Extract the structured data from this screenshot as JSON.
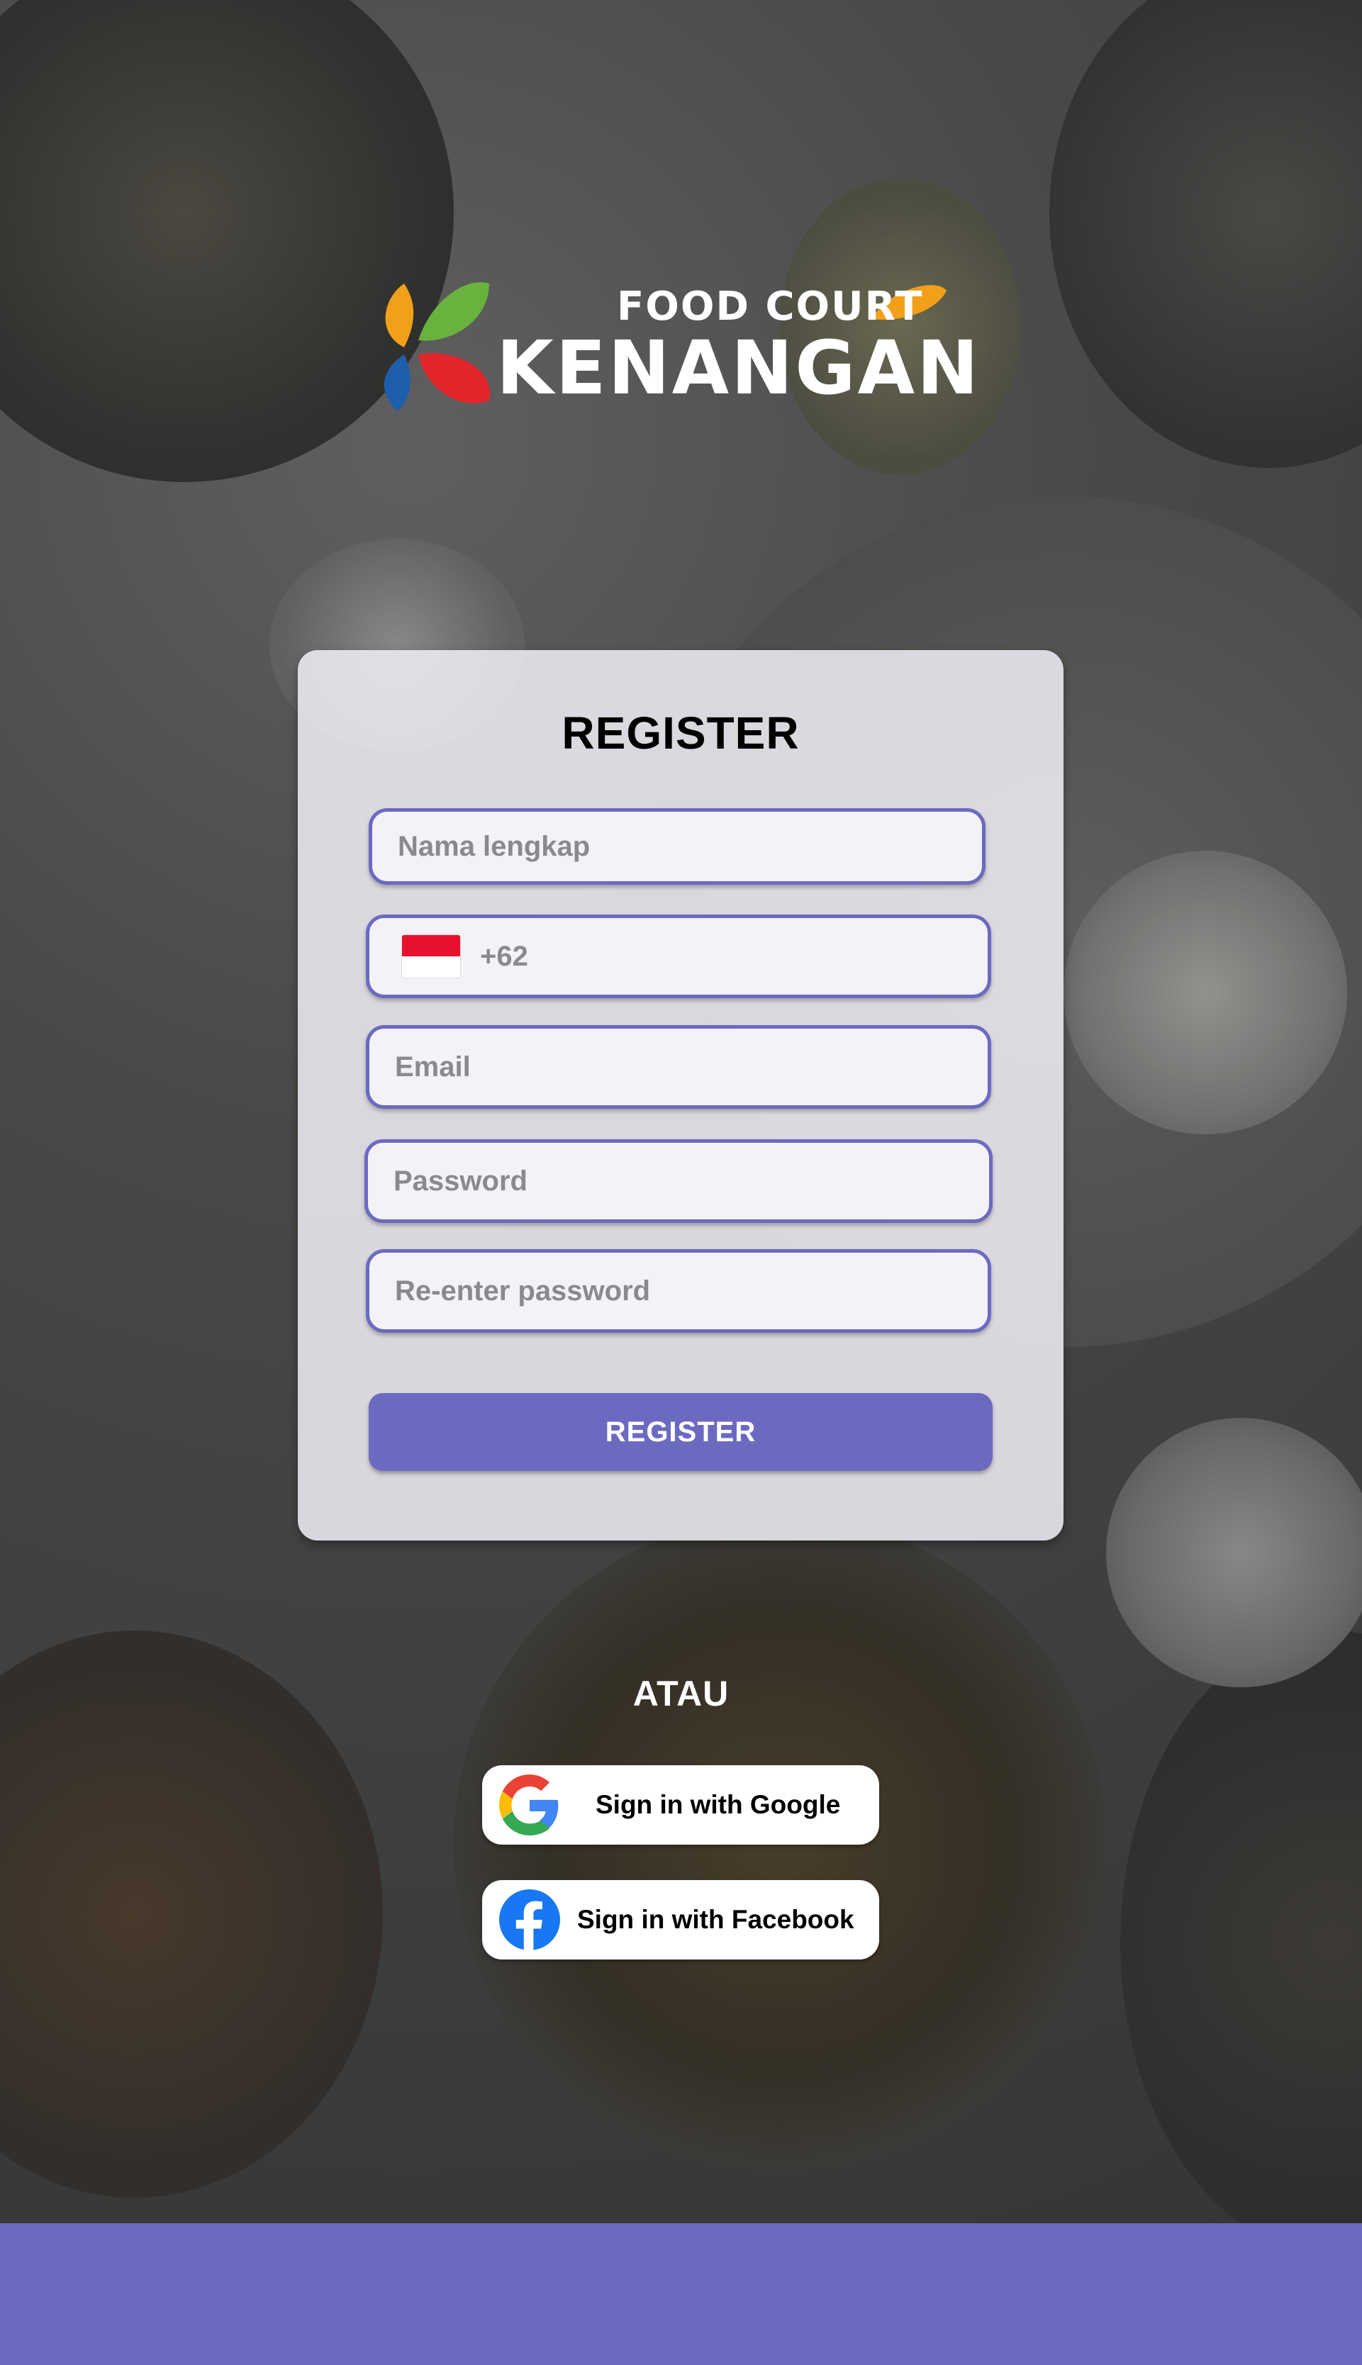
{
  "brand": {
    "small_text": "FOOD COURT",
    "big_text": "KENANGAN",
    "colors": {
      "leaf_green": "#6ab23e",
      "leaf_orange": "#f2a01a",
      "leaf_red": "#e2262c",
      "leaf_blue": "#1e5fab"
    }
  },
  "form": {
    "title": "REGISTER",
    "name_placeholder": "Nama lengkap",
    "phone_prefix": "+62",
    "phone_flag": "indonesia-flag",
    "email_placeholder": "Email",
    "password_placeholder": "Password",
    "repassword_placeholder": "Re-enter password",
    "submit_label": "REGISTER"
  },
  "divider": "ATAU",
  "social": {
    "google_label": "Sign in with Google",
    "facebook_label": "Sign in with Facebook"
  },
  "theme": {
    "accent": "#6c6ac0",
    "card_bg": "#ececf2",
    "field_bg": "#f3f2f7"
  }
}
